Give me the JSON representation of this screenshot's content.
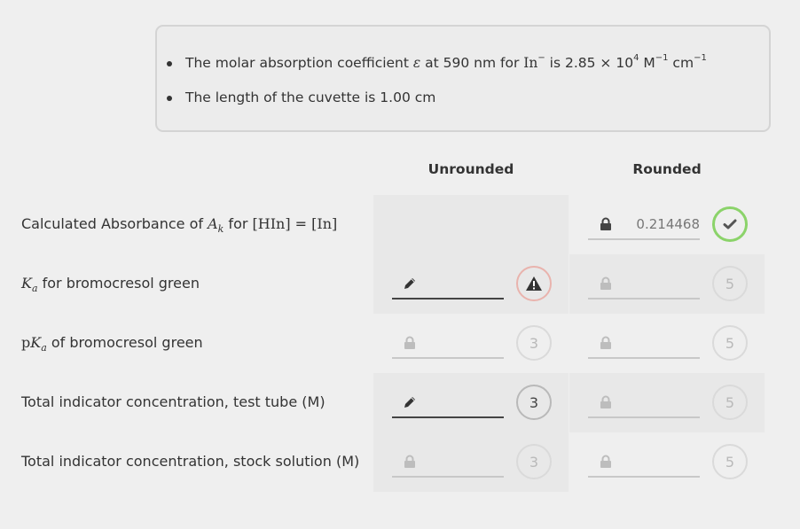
{
  "info": {
    "line1": {
      "pre": "The molar absorption coefficient ",
      "symbol": "ε",
      "mid": " at 590 nm for ",
      "species": "In",
      "species_sup": "−",
      "post": " is 2.85 × 10",
      "exp": "4",
      "unit1": " M",
      "unit1_exp": "−1",
      "unit2": " cm",
      "unit2_exp": "−1"
    },
    "line2": "The length of the cuvette is 1.00 cm"
  },
  "columns": {
    "unrounded": "Unrounded",
    "rounded": "Rounded"
  },
  "rows": [
    {
      "label_pre": "Calculated Absorbance of ",
      "label_sym": "A",
      "label_sub": "k",
      "label_mid": " for ",
      "label_hin": "[HIn]",
      "label_eq": " = ",
      "label_in": "[In]",
      "unrounded": null,
      "rounded": {
        "state": "locked",
        "value": "0.214468",
        "badge": "check",
        "status": "correct"
      }
    },
    {
      "label_sym": "K",
      "label_sub": "a",
      "label_post": " for bromocresol green",
      "unrounded": {
        "state": "editable",
        "value": "",
        "badge": "warning",
        "status": "warning"
      },
      "rounded": {
        "state": "locked",
        "value": "",
        "badge": "5"
      }
    },
    {
      "label_pre": "p",
      "label_sym": "K",
      "label_sub": "a",
      "label_post": " of bromocresol green",
      "unrounded": {
        "state": "locked",
        "value": "",
        "badge": "3"
      },
      "rounded": {
        "state": "locked",
        "value": "",
        "badge": "5"
      }
    },
    {
      "label": "Total indicator concentration, test tube (M)",
      "unrounded": {
        "state": "editable",
        "value": "",
        "badge": "3"
      },
      "rounded": {
        "state": "locked",
        "value": "",
        "badge": "5"
      }
    },
    {
      "label": "Total indicator concentration, stock solution (M)",
      "unrounded": {
        "state": "locked",
        "value": "",
        "badge": "3"
      },
      "rounded": {
        "state": "locked",
        "value": "",
        "badge": "5"
      }
    }
  ],
  "colors": {
    "correct": "#8bd36a",
    "warning": "#e9b3ad",
    "text": "#333333"
  }
}
